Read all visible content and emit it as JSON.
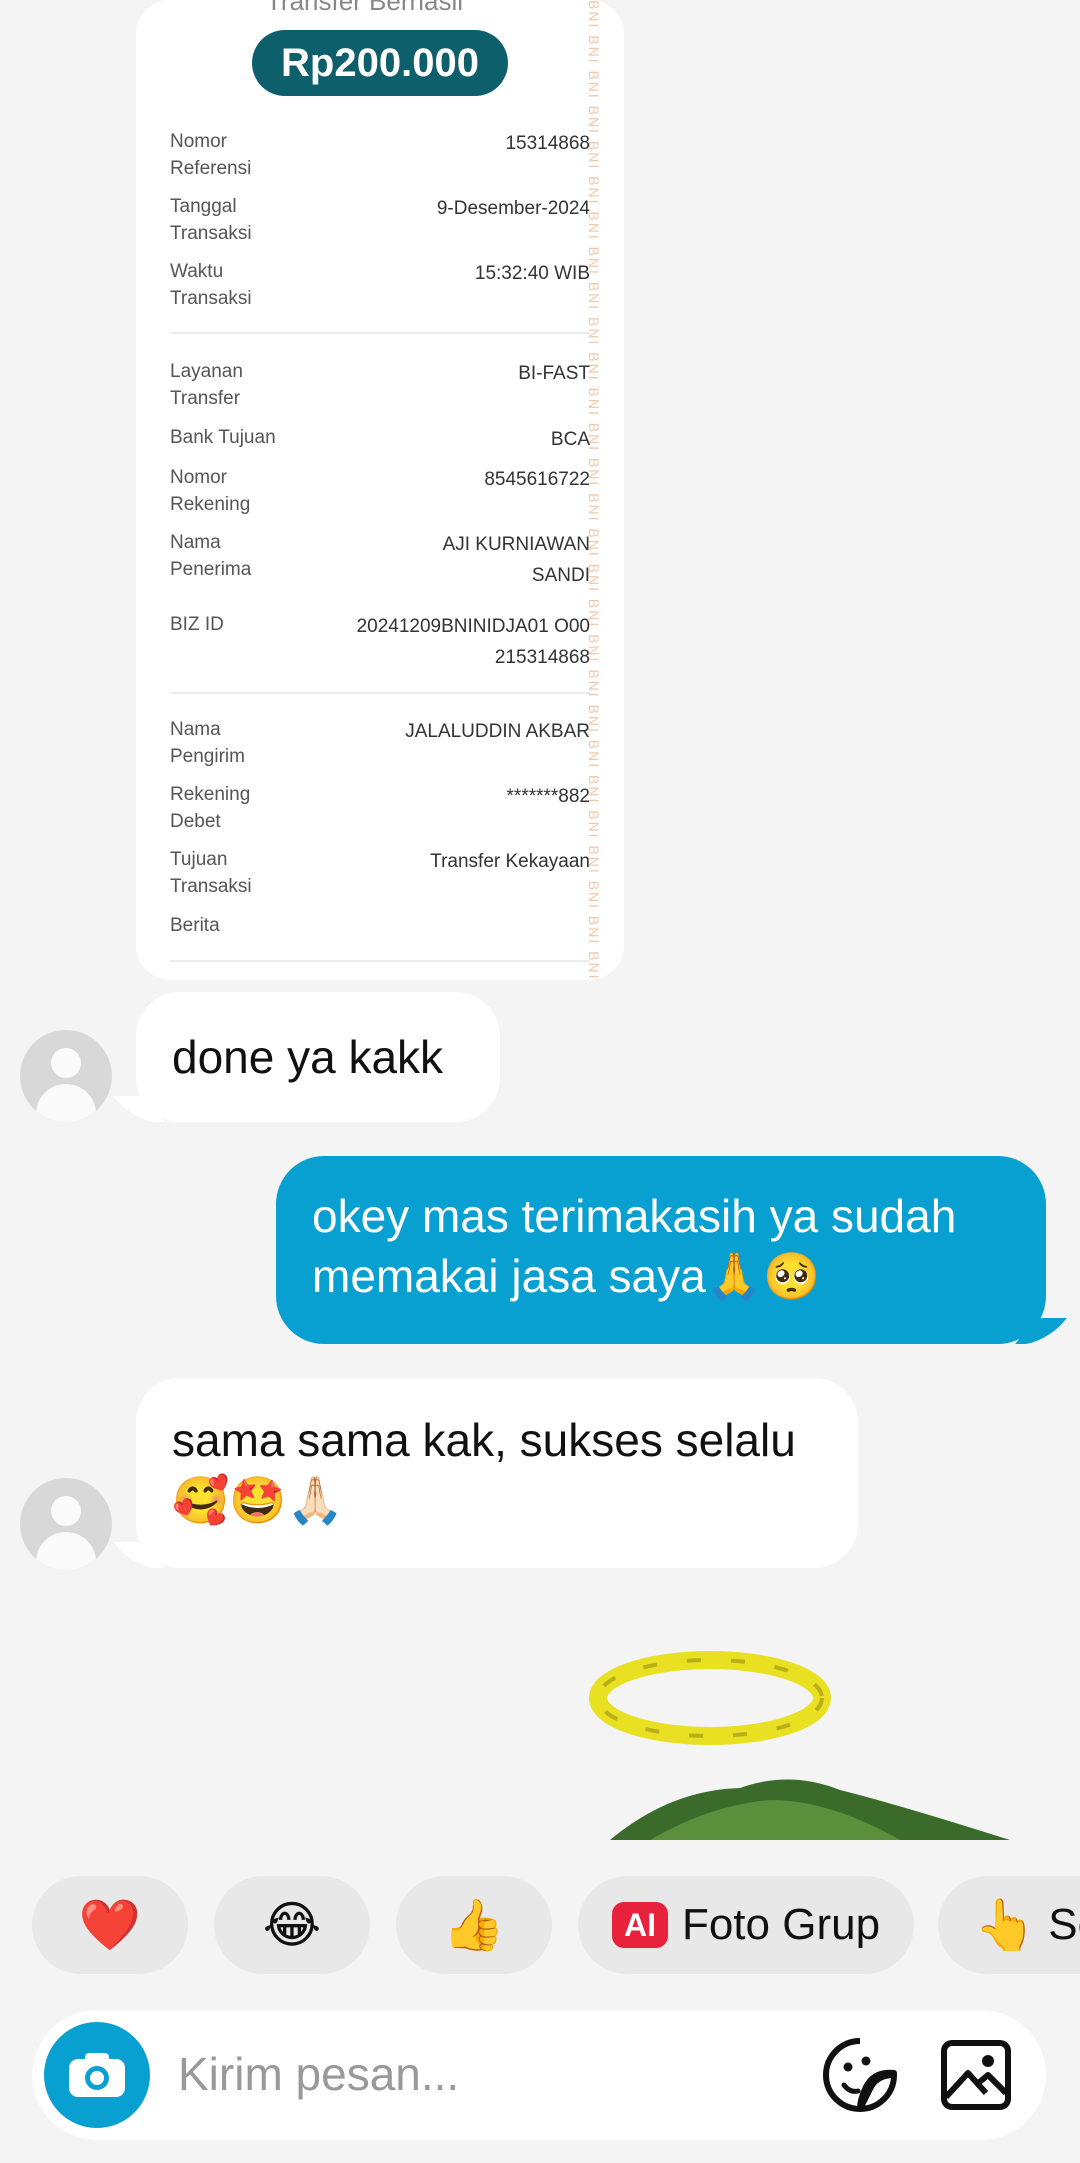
{
  "receipt": {
    "partial_header": "Transfer Berhasil",
    "amount": "Rp200.000",
    "watermark": "BNI",
    "sections": [
      [
        {
          "label": "Nomor Referensi",
          "value": "15314868"
        },
        {
          "label": "Tanggal Transaksi",
          "value": "9-Desember-2024"
        },
        {
          "label": "Waktu Transaksi",
          "value": "15:32:40 WIB"
        }
      ],
      [
        {
          "label": "Layanan Transfer",
          "value": "BI-FAST"
        },
        {
          "label": "Bank Tujuan",
          "value": "BCA"
        },
        {
          "label": "Nomor Rekening",
          "value": "8545616722"
        },
        {
          "label": "Nama Penerima",
          "value": "AJI KURNIAWAN SANDI"
        },
        {
          "label": "BIZ ID",
          "value": "20241209BNINIDJA01 O00215314868"
        }
      ],
      [
        {
          "label": "Nama Pengirim",
          "value": "JALALUDDIN AKBAR"
        },
        {
          "label": "Rekening Debet",
          "value": "*******882"
        },
        {
          "label": "Tujuan Transaksi",
          "value": "Transfer Kekayaan"
        },
        {
          "label": "Berita",
          "value": ""
        }
      ]
    ]
  },
  "messages": [
    {
      "from": "other",
      "text": "done ya kakk"
    },
    {
      "from": "me",
      "text": "okey mas terimakasih ya sudah\nmemakai jasa saya🙏🥺"
    },
    {
      "from": "other",
      "text": "sama sama kak, sukses selalu\n🥰🤩🙏🏻"
    }
  ],
  "quick_replies": [
    {
      "emoji": "❤️"
    },
    {
      "emoji": "😂"
    },
    {
      "emoji": "👍"
    },
    {
      "badge": "AI",
      "label": "Foto Grup"
    },
    {
      "emoji": "👆",
      "label": "Se"
    }
  ],
  "composer": {
    "placeholder": "Kirim pesan...",
    "icons": [
      "camera-icon",
      "sticker-icon",
      "gallery-icon"
    ]
  },
  "colors": {
    "outgoing_bubble": "#08a0d1",
    "amount_pill": "#0e5f6c",
    "background": "#f4f4f4"
  }
}
